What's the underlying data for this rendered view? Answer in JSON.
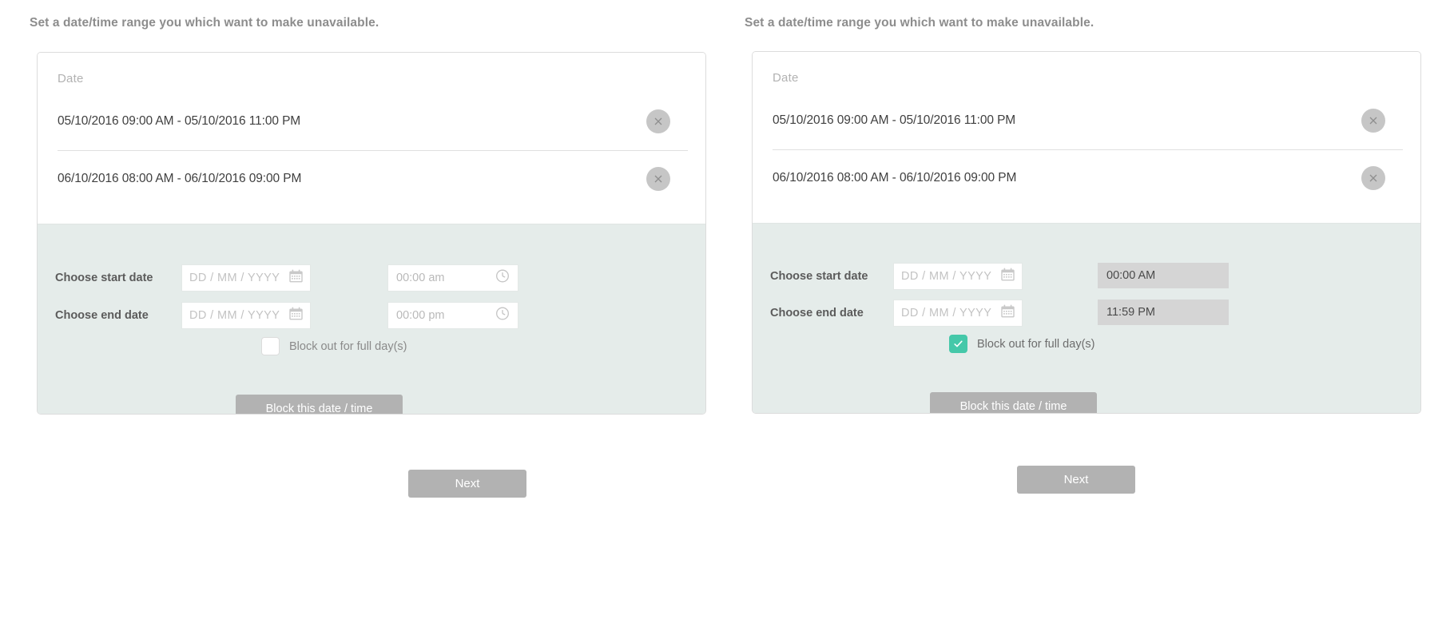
{
  "panels": [
    {
      "id": "left",
      "intro": "Set a date/time range you which want to make unavailable.",
      "date_header": "Date",
      "blocked_ranges": [
        "05/10/2016 09:00 AM - 05/10/2016 11:00 PM",
        "06/10/2016 08:00 AM - 06/10/2016 09:00 PM"
      ],
      "start_label": "Choose start date",
      "end_label": "Choose end date",
      "date_placeholder": "DD / MM / YYYY",
      "start_time_placeholder": "00:00 am",
      "end_time_placeholder": "00:00 pm",
      "start_time_value": "",
      "end_time_value": "",
      "full_day_label": "Block out for full day(s)",
      "full_day_checked": false,
      "block_button": "Block this date / time",
      "next_button": "Next"
    },
    {
      "id": "right",
      "intro": "Set a date/time range you which want to make unavailable.",
      "date_header": "Date",
      "blocked_ranges": [
        "05/10/2016 09:00 AM - 05/10/2016 11:00 PM",
        "06/10/2016 08:00 AM - 06/10/2016 09:00 PM"
      ],
      "start_label": "Choose start date",
      "end_label": "Choose end date",
      "date_placeholder": "DD / MM / YYYY",
      "start_time_placeholder": "",
      "end_time_placeholder": "",
      "start_time_value": "00:00 AM",
      "end_time_value": "11:59 PM",
      "full_day_label": "Block out for full day(s)",
      "full_day_checked": true,
      "block_button": "Block this date / time",
      "next_button": "Next"
    }
  ],
  "icons": {
    "remove": "close-circle-icon",
    "calendar": "calendar-icon",
    "clock": "clock-icon",
    "check": "check-icon"
  },
  "colors": {
    "panel_green": "#e5ecea",
    "accent_teal": "#45c8a9",
    "button_gray": "#b2b2b2",
    "disabled_field": "#d5d5d5",
    "text_dark": "#3f3f3f",
    "text_muted": "#8d8d8d"
  }
}
